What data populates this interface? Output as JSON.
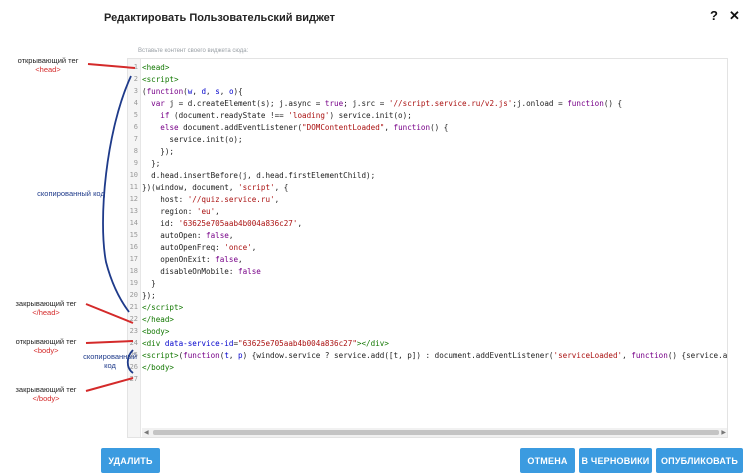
{
  "dialog": {
    "title": "Редактировать Пользовательский виджет",
    "help_label": "?",
    "close_label": "✕",
    "hint": "Вставьте контент своего виджета сюда:"
  },
  "editor": {
    "line_numbers": [
      "1",
      "2",
      "3",
      "4",
      "5",
      "6",
      "7",
      "8",
      "9",
      "10",
      "11",
      "12",
      "13",
      "14",
      "15",
      "16",
      "17",
      "18",
      "19",
      "20",
      "21",
      "22",
      "23",
      "24",
      "25",
      "26",
      "27"
    ]
  },
  "footer": {
    "delete_label": "УДАЛИТЬ",
    "cancel_label": "ОТМЕНА",
    "draft_label": "В ЧЕРНОВИКИ",
    "publish_label": "ОПУБЛИКОВАТЬ"
  },
  "annotations": {
    "opening_tag": "открывающий тег",
    "head_tag": "<head>",
    "copied_code": "скопированный код",
    "closing_tag": "закрывающий тег",
    "head_close_tag": "</head>",
    "body_tag": "<body>",
    "copied_code_2": "скопированный код",
    "body_close_tag": "</body>"
  },
  "colors": {
    "accent": "#3b9be0",
    "annotation_red": "#d42a2a",
    "annotation_blue": "#1e3a8a"
  }
}
